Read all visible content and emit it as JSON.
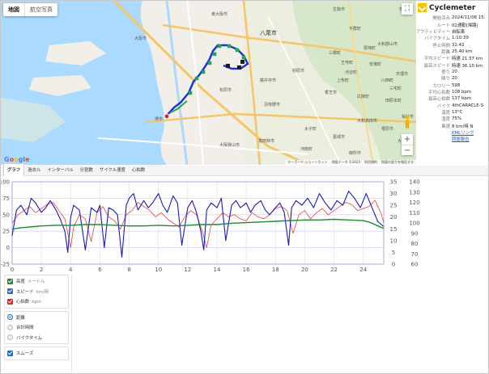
{
  "map": {
    "tabs": [
      "地図",
      "航空写真"
    ],
    "attribution": [
      "キーボード ショートカット",
      "地図データ ©2024",
      "利用規約",
      "地図の誤りを報告する"
    ],
    "places": [
      "八尾市",
      "東大阪市",
      "大阪市",
      "堺市",
      "松原市",
      "藤井寺市",
      "羽曳野市",
      "柏原市",
      "生駒市",
      "平群町",
      "大和郡山市",
      "天理市",
      "奈良",
      "斑鳩町",
      "王寺町",
      "香芝市",
      "大和高田市",
      "河合町",
      "三郷町",
      "上牧町",
      "広陵町",
      "田原本町",
      "川西町",
      "安堵町",
      "三宅町",
      "橿原市",
      "桜井市",
      "大和",
      "富田林市",
      "河南町",
      "太子町",
      "大阪狭山市",
      "葛城市",
      "御所市"
    ]
  },
  "info": {
    "brand": "Cyclemeter",
    "rows": [
      {
        "k": "開始済み",
        "v": "2024/11/06 15:"
      },
      {
        "k": "ルート",
        "v": "02通勤(帰路)"
      },
      {
        "k": "アクティビティー",
        "v": "自転車"
      },
      {
        "k": "バイクタイム",
        "v": "1:10:39"
      },
      {
        "k": "停止時間",
        "v": "31:42"
      },
      {
        "k": "距離",
        "v": "25.40 km"
      },
      {
        "k": "平均スピード",
        "v": "時速 21.57 km"
      },
      {
        "k": "最高スピード",
        "v": "時速 36.10 km"
      },
      {
        "k": "登り",
        "v": "20"
      },
      {
        "k": "降り",
        "v": "20"
      },
      {
        "k": "カロリー",
        "v": "598"
      },
      {
        "k": "平均心拍数",
        "v": "108 bpm"
      },
      {
        "k": "最高心拍数",
        "v": "137 bpm"
      },
      {
        "k": "バイク",
        "v": "4thCARACLE-S"
      },
      {
        "k": "温度",
        "v": "13°C"
      },
      {
        "k": "湿度",
        "v": "75%"
      },
      {
        "k": "風速",
        "v": "8 km/時 N"
      }
    ],
    "links": [
      "KMLリンク",
      "問題報告"
    ]
  },
  "tabs": [
    "グラフ",
    "過去ル",
    "インターバル",
    "分割数",
    "サイクル速度",
    "心拍数"
  ],
  "options": {
    "metrics": [
      {
        "label": "高度",
        "unit": "メートル",
        "color": "#1f8a2e",
        "checked": true
      },
      {
        "label": "スピード",
        "unit": "km/時",
        "color": "#1a6fc8",
        "checked": true
      },
      {
        "label": "心拍数",
        "unit": "bpm",
        "color": "#d42b2b",
        "checked": true
      }
    ],
    "modes": [
      {
        "label": "距離",
        "checked": true
      },
      {
        "label": "合計時間",
        "checked": false
      },
      {
        "label": "バイクタイム",
        "checked": false
      }
    ],
    "smoothing": {
      "label": "スムーズ",
      "checked": true
    }
  },
  "chart_data": {
    "type": "line",
    "x_ticks": [
      "0",
      "2",
      "4",
      "6",
      "8",
      "10",
      "12",
      "14",
      "16",
      "18",
      "20",
      "22",
      "24"
    ],
    "xlim": [
      0,
      25.4
    ],
    "y_left_ticks": [
      "100",
      "75",
      "50",
      "25",
      "0",
      "-25"
    ],
    "y_left_lim": [
      -25,
      100
    ],
    "y_mid_ticks": [
      "35",
      "30",
      "25",
      "20",
      "15",
      "10",
      "5",
      "0"
    ],
    "y_mid_lim": [
      0,
      35
    ],
    "y_right_ticks": [
      "140",
      "130",
      "120",
      "110",
      "100",
      "90",
      "80",
      "70",
      "60"
    ],
    "y_right_lim": [
      60,
      140
    ],
    "colors": {
      "elevation": "#1f8a2e",
      "speed": "#1a1ac0",
      "heart": "#e04545"
    },
    "series": [
      {
        "key": "elevation",
        "x": [
          0,
          0.5,
          1,
          1.5,
          2,
          3,
          4,
          5,
          6,
          7,
          8,
          9,
          10,
          11,
          12,
          13,
          14,
          15,
          16,
          17,
          18,
          19,
          20,
          21,
          22,
          23,
          24,
          24.5,
          25,
          25.4
        ],
        "values": [
          28,
          30,
          31,
          32,
          33,
          34,
          34,
          35,
          35,
          34,
          33,
          33,
          34,
          33,
          34,
          35,
          35,
          37,
          38,
          39,
          40,
          41,
          42,
          42,
          43,
          42,
          41,
          38,
          33,
          29
        ]
      },
      {
        "key": "speed",
        "x": [
          0,
          0.3,
          0.6,
          1,
          1.3,
          1.6,
          2,
          2.3,
          2.6,
          3,
          3.3,
          3.6,
          3.8,
          4,
          4.2,
          4.6,
          5,
          5.4,
          5.8,
          6,
          6.3,
          6.6,
          6.9,
          7.2,
          7.5,
          7.8,
          8,
          8.3,
          8.6,
          9,
          9.3,
          9.6,
          10,
          10.3,
          10.6,
          11,
          11.3,
          11.6,
          12,
          12.3,
          12.6,
          12.9,
          13.1,
          13.3,
          13.6,
          14,
          14.3,
          14.6,
          15,
          15.3,
          15.6,
          16,
          16.3,
          16.6,
          17,
          17.3,
          17.6,
          18,
          18.3,
          18.6,
          18.9,
          19.1,
          19.4,
          19.8,
          20.2,
          20.6,
          21,
          21.4,
          21.8,
          22.2,
          22.6,
          23,
          23.4,
          23.8,
          24.2,
          24.6,
          25,
          25.4
        ],
        "values": [
          12,
          23,
          25,
          21,
          28,
          26,
          22,
          24,
          27,
          23,
          19,
          14,
          5,
          20,
          25,
          23,
          6,
          24,
          22,
          25,
          7,
          24,
          23,
          21,
          3,
          25,
          28,
          30,
          23,
          27,
          24,
          26,
          30,
          25,
          22,
          29,
          26,
          8,
          24,
          27,
          22,
          14,
          6,
          23,
          26,
          24,
          28,
          10,
          25,
          27,
          24,
          26,
          22,
          25,
          27,
          23,
          21,
          24,
          26,
          22,
          8,
          24,
          27,
          25,
          28,
          24,
          30,
          26,
          23,
          27,
          25,
          31,
          28,
          24,
          30,
          24,
          18,
          16
        ]
      },
      {
        "key": "heart",
        "x": [
          0,
          0.4,
          0.8,
          1.2,
          1.6,
          2,
          2.4,
          2.8,
          3.2,
          3.6,
          4,
          4.2,
          4.6,
          5,
          5.4,
          5.8,
          6.2,
          6.6,
          7,
          7.4,
          7.8,
          8.2,
          8.6,
          9,
          9.4,
          9.8,
          10.2,
          10.6,
          11,
          11.4,
          11.8,
          12.2,
          12.6,
          13,
          13.3,
          13.6,
          14,
          14.4,
          14.8,
          15.2,
          15.6,
          16,
          16.4,
          16.8,
          17.2,
          17.6,
          18,
          18.4,
          18.8,
          19.2,
          19.6,
          20,
          20.4,
          20.8,
          21.2,
          21.6,
          22,
          22.4,
          22.8,
          23.2,
          23.6,
          24,
          24.4,
          24.8,
          25.2,
          25.4
        ],
        "values": [
          100,
          108,
          112,
          116,
          110,
          114,
          118,
          120,
          112,
          104,
          76,
          96,
          108,
          104,
          82,
          110,
          116,
          106,
          102,
          94,
          108,
          112,
          120,
          116,
          112,
          106,
          110,
          104,
          100,
          96,
          106,
          112,
          108,
          92,
          76,
          98,
          104,
          110,
          106,
          108,
          104,
          102,
          110,
          106,
          104,
          108,
          114,
          116,
          112,
          90,
          108,
          112,
          104,
          110,
          114,
          108,
          112,
          116,
          120,
          118,
          112,
          114,
          116,
          122,
          110,
          100
        ]
      }
    ]
  }
}
